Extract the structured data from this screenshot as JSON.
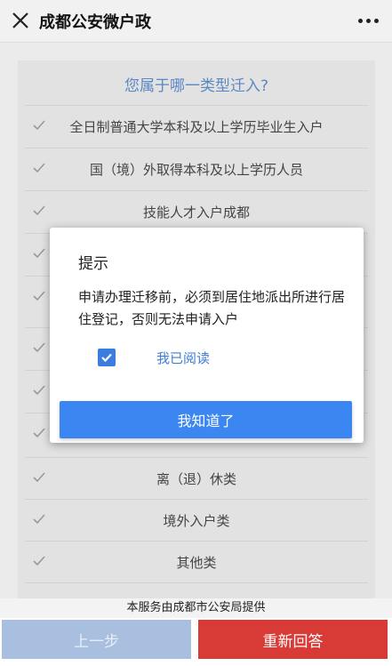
{
  "window": {
    "title": "成都公安微户政"
  },
  "question": "您属于哪一类型迁入?",
  "options": [
    {
      "label": "全日制普通大学本科及以上学历毕业生入户"
    },
    {
      "label": "国（境）外取得本科及以上学历人员"
    },
    {
      "label": "技能人才入户成都"
    },
    {
      "label": ""
    },
    {
      "label": ""
    },
    {
      "label": ""
    },
    {
      "label": ""
    },
    {
      "label": ""
    },
    {
      "label": "离（退）休类"
    },
    {
      "label": "境外入户类"
    },
    {
      "label": "其他类"
    }
  ],
  "dialog": {
    "title": "提示",
    "message": "申请办理迁移前，必须到居住地派出所进行居住登记，否则无法申请入户",
    "checkbox_label": "我已阅读",
    "checkbox_checked": true,
    "ok_label": "我知道了"
  },
  "footer_note": "本服务由成都市公安局提供",
  "buttons": {
    "prev": "上一步",
    "reset": "重新回答"
  },
  "colors": {
    "accent": "#3b86f0",
    "danger": "#d83a36",
    "question": "#5b87c4"
  }
}
